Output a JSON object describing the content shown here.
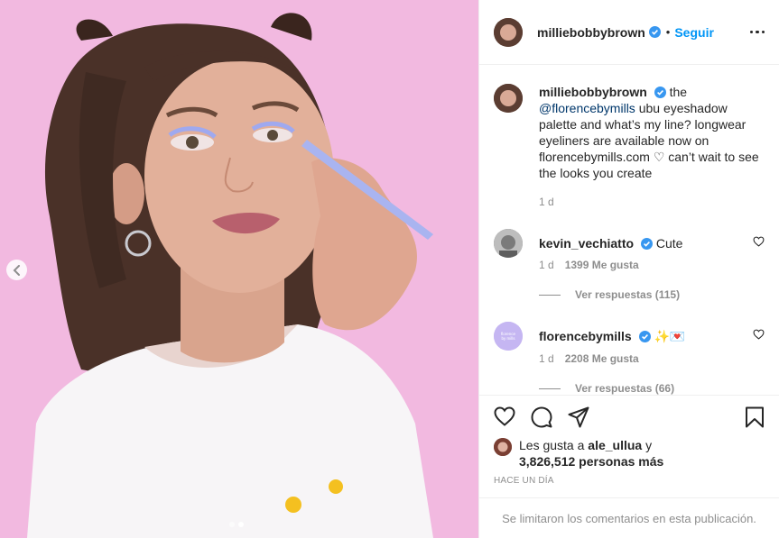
{
  "post": {
    "username": "milliebobbybrown",
    "separator": "•",
    "follow_label": "Seguir",
    "caption_parts": {
      "before_mention": "the ",
      "mention": "@florencebymills",
      "after_mention": " ubu eyeshadow palette and what’s my line? longwear eyeliners are available now on florencebymills.com ♡ can’t wait to see the looks you create"
    },
    "caption_time": "1 d"
  },
  "comments": [
    {
      "username": "kevin_vechiatto",
      "text": "Cute",
      "time": "1 d",
      "likes": "1399 Me gusta",
      "replies": "Ver respuestas (115)"
    },
    {
      "username": "florencebymills",
      "text": "✨💌",
      "time": "1 d",
      "likes": "2208 Me gusta",
      "replies": "Ver respuestas (66)",
      "avatar_text": "florence by mills"
    }
  ],
  "likes_summary": {
    "prefix": "Les gusta a ",
    "user": "ale_ullua",
    "middle": " y",
    "count": "3,826,512 personas más"
  },
  "timestamp": "HACE UN DÍA",
  "comments_limited": "Se limitaron los comentarios en esta publicación.",
  "carousel": {
    "total": 2,
    "current": 2
  },
  "colors": {
    "accent": "#0095f6",
    "verified": "#3897f0",
    "photo_bg": "#f0b8de",
    "secondary_text": "#8e8e8e"
  },
  "icons": [
    "verified-icon",
    "more-icon",
    "heart-icon",
    "comment-icon",
    "share-icon",
    "save-icon",
    "chevron-left-icon"
  ]
}
